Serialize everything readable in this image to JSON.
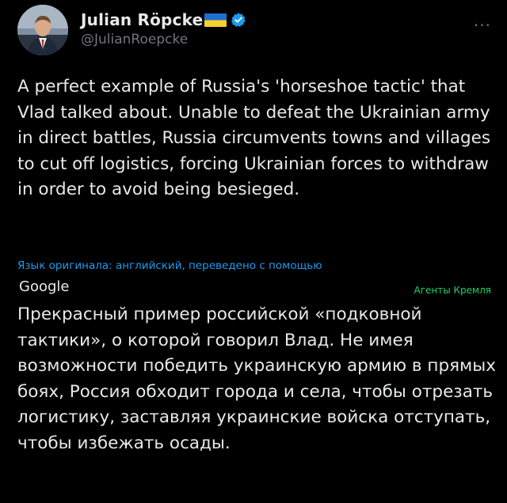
{
  "author": {
    "name": "Julian Röpcke",
    "handle": "@JulianRoepcke",
    "flag_icon": "ukraine-flag",
    "verified_icon": "verified-badge",
    "verified_color": "#1d9bf0"
  },
  "menu": {
    "more_label": "···"
  },
  "tweet": {
    "text": "A perfect example of Russia's 'horseshoe tactic' that Vlad talked about. Unable to defeat the Ukrainian army in direct battles, Russia circumvents towns and villages to cut off logistics, forcing Ukrainian forces to withdraw in order to avoid being besieged."
  },
  "translation": {
    "note": "Язык оригинала: английский, переведено с помощью",
    "provider": "Google",
    "overlay_label": "Агенты Кремля",
    "text": "Прекрасный пример российской «подковной тактики», о которой говорил Влад. Не имея возможности победить украинскую армию в прямых боях, Россия обходит города и села, чтобы отрезать логистику, заставляя украинские войска отступать, чтобы избежать осады."
  },
  "colors": {
    "background": "#000000",
    "text": "#e7e9ea",
    "secondary": "#71767b",
    "link": "#1d9bf0",
    "overlay_green": "#1bd16a"
  }
}
